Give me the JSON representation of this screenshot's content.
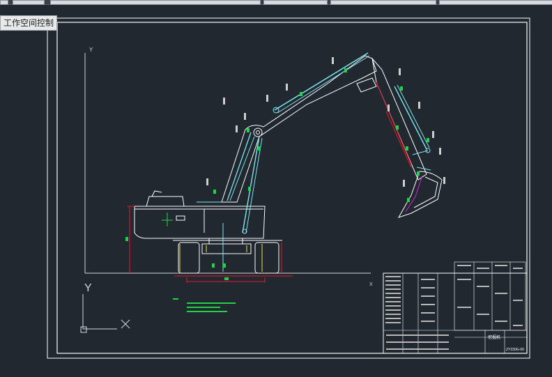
{
  "workspace": {
    "label": "工作空间控制"
  },
  "drawing": {
    "axis_y": "Y",
    "axis_x": "X",
    "ucs_y": "Y",
    "colors": {
      "background": "#212830",
      "frame": "#ffffff",
      "cyan": "#7fe8f0",
      "green": "#22d34a",
      "red": "#e01a2a",
      "magenta": "#e020e0",
      "yellow": "#e6e640"
    }
  },
  "title_block": {
    "part_title": "挖掘机",
    "drawing_number": "ZY230G-00"
  }
}
